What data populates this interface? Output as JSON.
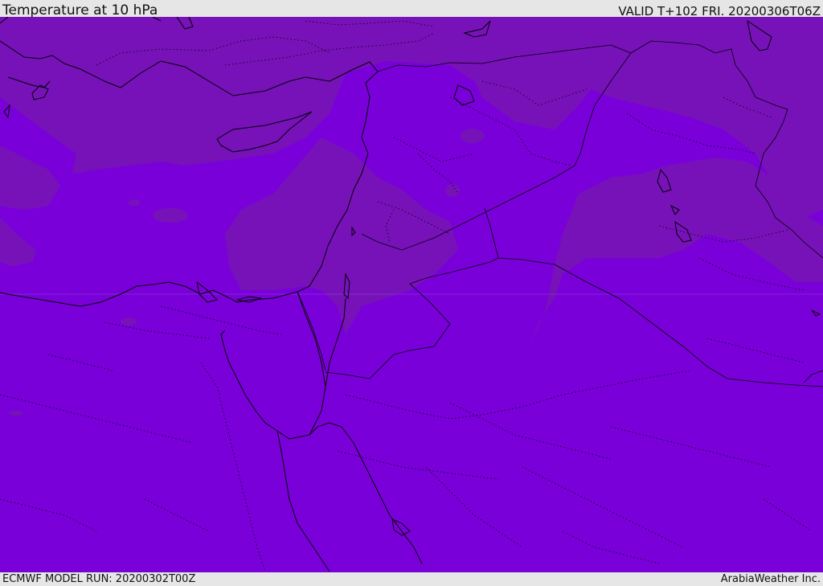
{
  "header": {
    "title": "Temperature at 10 hPa",
    "valid_time": "VALID T+102 FRI. 20200306T06Z"
  },
  "footer": {
    "model_run": "ECMWF MODEL RUN: 20200302T00Z",
    "credit": "ArabiaWeather Inc."
  },
  "map": {
    "fill_base_color": "#7a00d9",
    "fill_band_color": "#7a12b8",
    "coastline_color": "#000000",
    "border_style": "dotted"
  }
}
